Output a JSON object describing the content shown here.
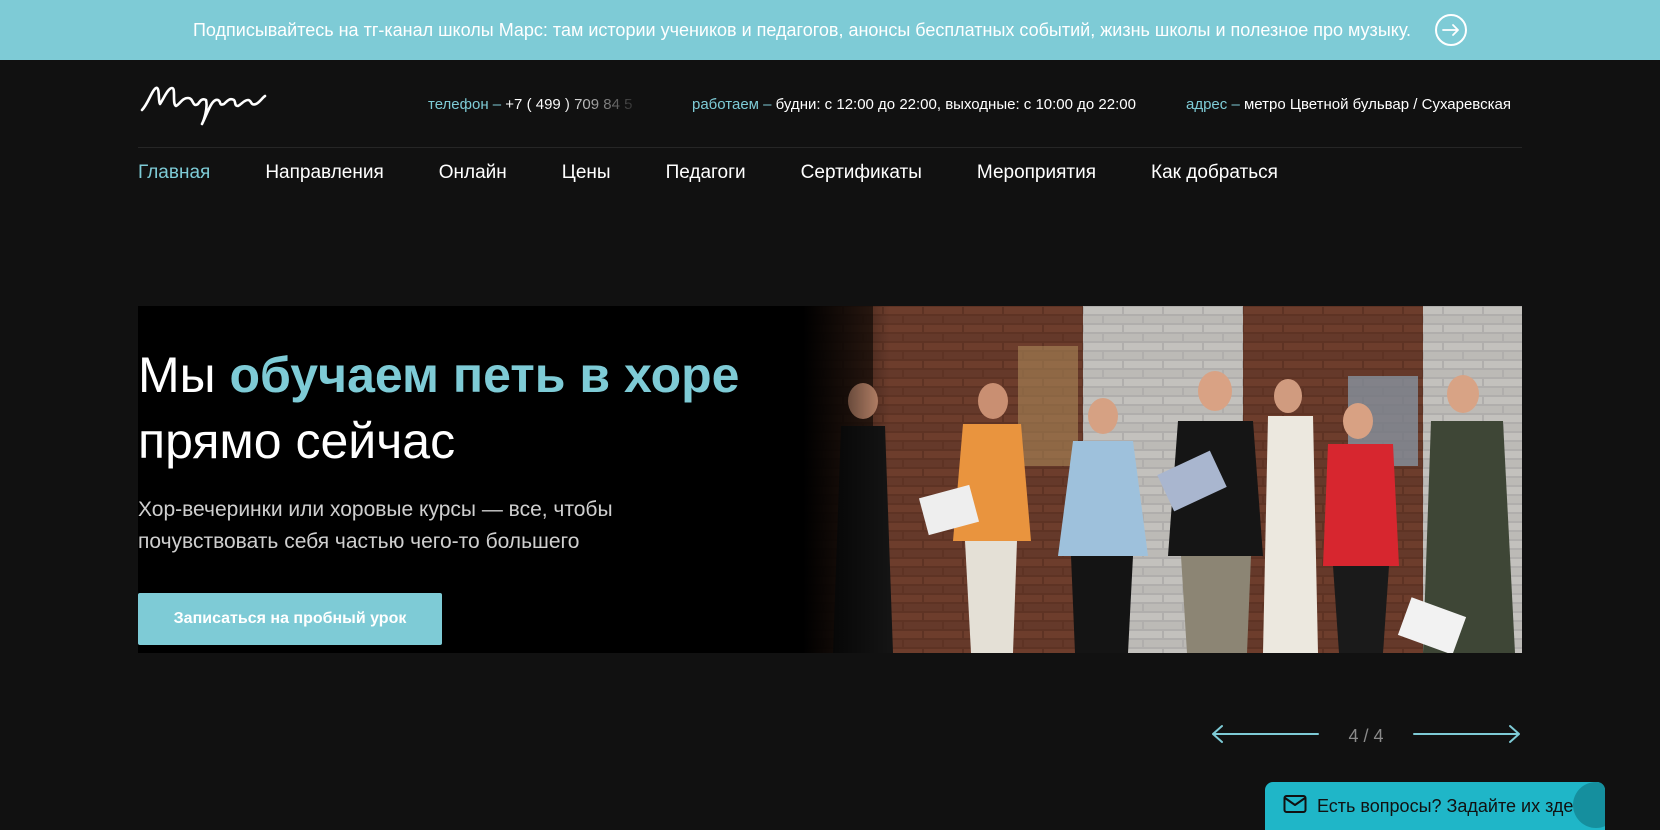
{
  "banner": {
    "text": "Подписывайтесь на тг-канал школы Марс: там истории учеников и педагогов, анонсы бесплатных событий, жизнь школы и полезное про музыку.",
    "arrow_icon": "arrow-right-circle-icon"
  },
  "header": {
    "logo_text": "Марс",
    "phone_label": "телефон –",
    "phone_value": "+7 ( 499 ) 709 84 5",
    "hours_label": "работаем –",
    "hours_value": "будни: с 12:00 до 22:00, выходные: с 10:00 до 22:00",
    "address_label": "адрес –",
    "address_value": "метро Цветной бульвар / Сухаревская"
  },
  "nav": {
    "items": [
      "Главная",
      "Направления",
      "Онлайн",
      "Цены",
      "Педагоги",
      "Сертификаты",
      "Мероприятия",
      "Как добраться"
    ],
    "active_index": 0
  },
  "hero": {
    "title_prefix": "Мы ",
    "title_accent": "обучаем петь в хоре",
    "title_line2": "прямо сейчас",
    "subtitle": "Хор-вечеринки или хоровые курсы — все, чтобы почувствовать себя частью чего-то большего",
    "cta_label": "Записаться на пробный урок"
  },
  "slider": {
    "current": 4,
    "total": 4,
    "counter_text": "4 / 4"
  },
  "chat": {
    "text": "Есть вопросы? Задайте их здесь.",
    "icon": "envelope-icon"
  },
  "colors": {
    "accent": "#7ecbd6",
    "background": "#111111",
    "chat": "#1fb6c8"
  }
}
